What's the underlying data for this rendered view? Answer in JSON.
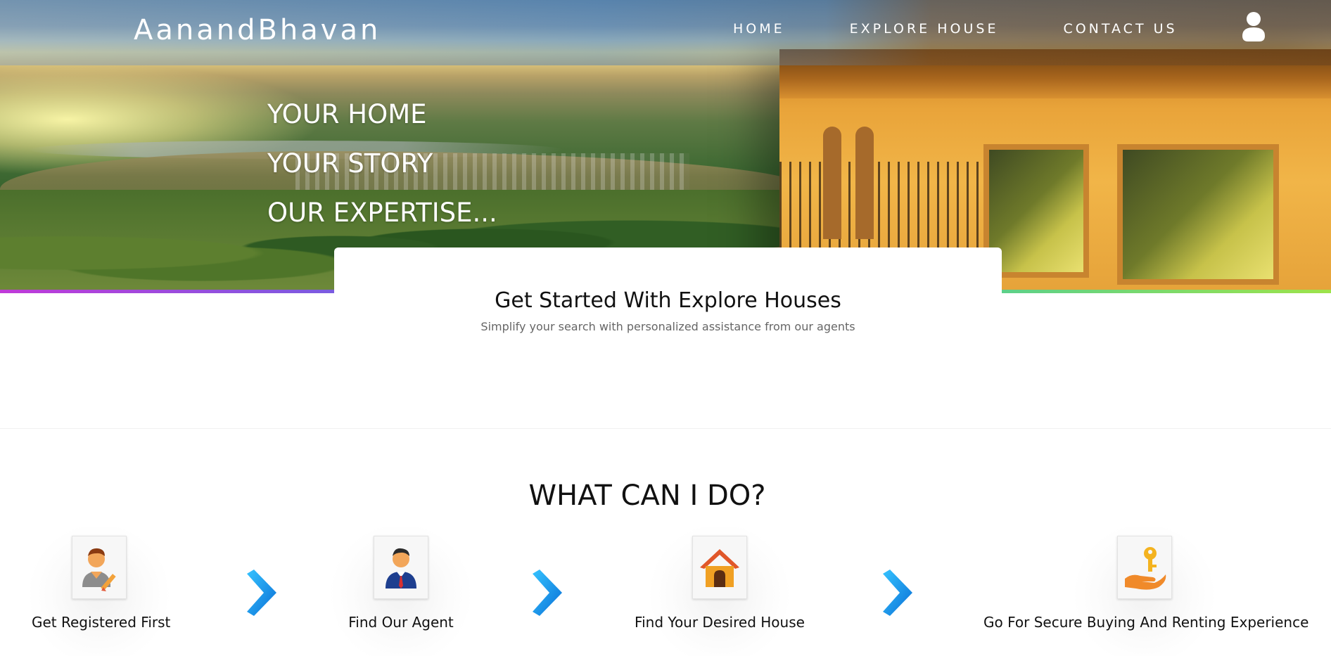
{
  "brand": {
    "name": "AanandBhavan"
  },
  "nav": {
    "items": [
      {
        "label": "HOME"
      },
      {
        "label": "EXPLORE HOUSE"
      },
      {
        "label": "CONTACT US"
      }
    ],
    "user_icon": "user-icon"
  },
  "hero": {
    "lines": [
      "YOUR HOME",
      "YOUR STORY",
      "OUR EXPERTISE..."
    ]
  },
  "get_started": {
    "title": "Get Started With Explore Houses",
    "subtitle": "Simplify your search with personalized assistance from our agents"
  },
  "what_section": {
    "title": "WHAT CAN I DO?",
    "steps": [
      {
        "label": "Get Registered First",
        "icon": "register-user-icon"
      },
      {
        "label": "Find Our Agent",
        "icon": "agent-icon"
      },
      {
        "label": "Find Your Desired House",
        "icon": "house-icon"
      },
      {
        "label": "Go For Secure Buying And Renting Experience",
        "icon": "key-in-hand-icon"
      }
    ],
    "arrow_icon": "chevron-right-icon"
  },
  "colors": {
    "arrow_blue": "#1e9be8",
    "stripe": [
      "#c03ad8",
      "#4aa0d8",
      "#9ee34a"
    ]
  }
}
